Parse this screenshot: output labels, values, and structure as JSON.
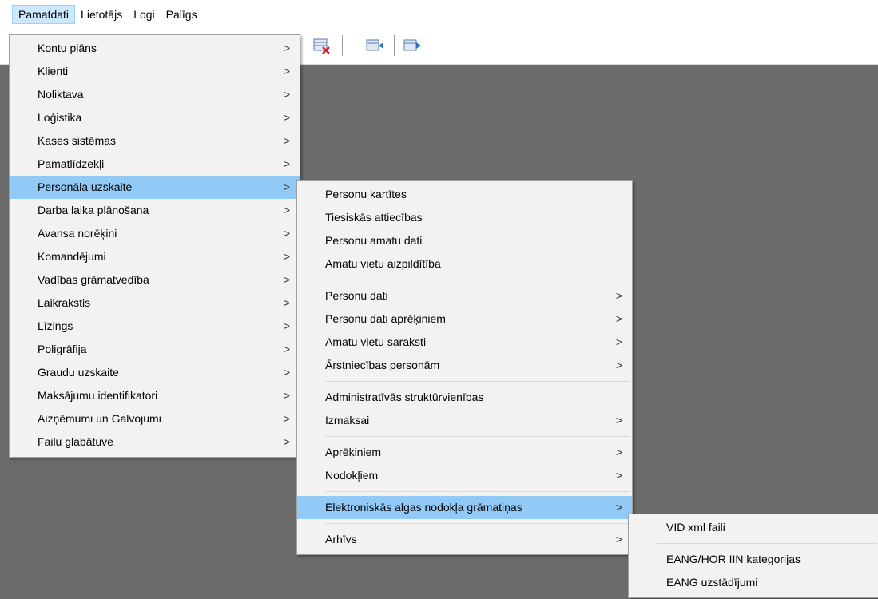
{
  "menubar": {
    "items": [
      {
        "label": "Pamatdati",
        "active": true
      },
      {
        "label": "Lietotājs"
      },
      {
        "label": "Logi"
      },
      {
        "label": "Palīgs"
      }
    ]
  },
  "menu_pamatdati": {
    "items": [
      {
        "label": "Kontu plāns",
        "arrow": ">"
      },
      {
        "label": "Klienti",
        "arrow": ">"
      },
      {
        "label": "Noliktava",
        "arrow": ">"
      },
      {
        "label": "Loģistika",
        "arrow": ">"
      },
      {
        "label": "Kases sistēmas",
        "arrow": ">"
      },
      {
        "label": "Pamatlīdzekļi",
        "arrow": ">"
      },
      {
        "label": "Personāla uzskaite",
        "arrow": ">",
        "highlighted": true
      },
      {
        "label": "Darba laika plānošana",
        "arrow": ">"
      },
      {
        "label": "Avansa norēķini",
        "arrow": ">"
      },
      {
        "label": "Komandējumi",
        "arrow": ">"
      },
      {
        "label": "Vadības grāmatvedība",
        "arrow": ">"
      },
      {
        "label": "Laikrakstis",
        "arrow": ">"
      },
      {
        "label": "Līzings",
        "arrow": ">"
      },
      {
        "label": "Poligrāfija",
        "arrow": ">"
      },
      {
        "label": "Graudu uzskaite",
        "arrow": ">"
      },
      {
        "label": "Maksājumu identifikatori",
        "arrow": ">"
      },
      {
        "label": "Aizņēmumi un Galvojumi",
        "arrow": ">"
      },
      {
        "label": "Failu glabātuve",
        "arrow": ">"
      }
    ]
  },
  "menu_personala": {
    "items": [
      {
        "label": "Personu kartītes"
      },
      {
        "label": "Tiesiskās attiecības"
      },
      {
        "label": "Personu amatu dati"
      },
      {
        "label": "Amatu vietu aizpildītība"
      },
      {
        "separator": true
      },
      {
        "label": "Personu dati",
        "arrow": ">"
      },
      {
        "label": "Personu dati aprēķiniem",
        "arrow": ">"
      },
      {
        "label": "Amatu vietu saraksti",
        "arrow": ">"
      },
      {
        "label": "Ārstniecības personām",
        "arrow": ">"
      },
      {
        "separator": true
      },
      {
        "label": "Administratīvās struktūrvienības"
      },
      {
        "label": "Izmaksai",
        "arrow": ">"
      },
      {
        "separator": true
      },
      {
        "label": "Aprēķiniem",
        "arrow": ">"
      },
      {
        "label": "Nodokļiem",
        "arrow": ">"
      },
      {
        "separator": true
      },
      {
        "label": "Elektroniskās algas nodokļa grāmatiņas",
        "arrow": ">",
        "highlighted": true
      },
      {
        "separator": true
      },
      {
        "label": "Arhīvs",
        "arrow": ">"
      }
    ]
  },
  "menu_eang": {
    "items": [
      {
        "label": "VID xml faili"
      },
      {
        "separator": true
      },
      {
        "label": "EANG/HOR IIN kategorijas"
      },
      {
        "label": "EANG uzstādījumi"
      }
    ]
  },
  "colors": {
    "workspace": "#6b6b6b",
    "menu_bg": "#f2f2f2",
    "highlight": "#91c9f7"
  }
}
